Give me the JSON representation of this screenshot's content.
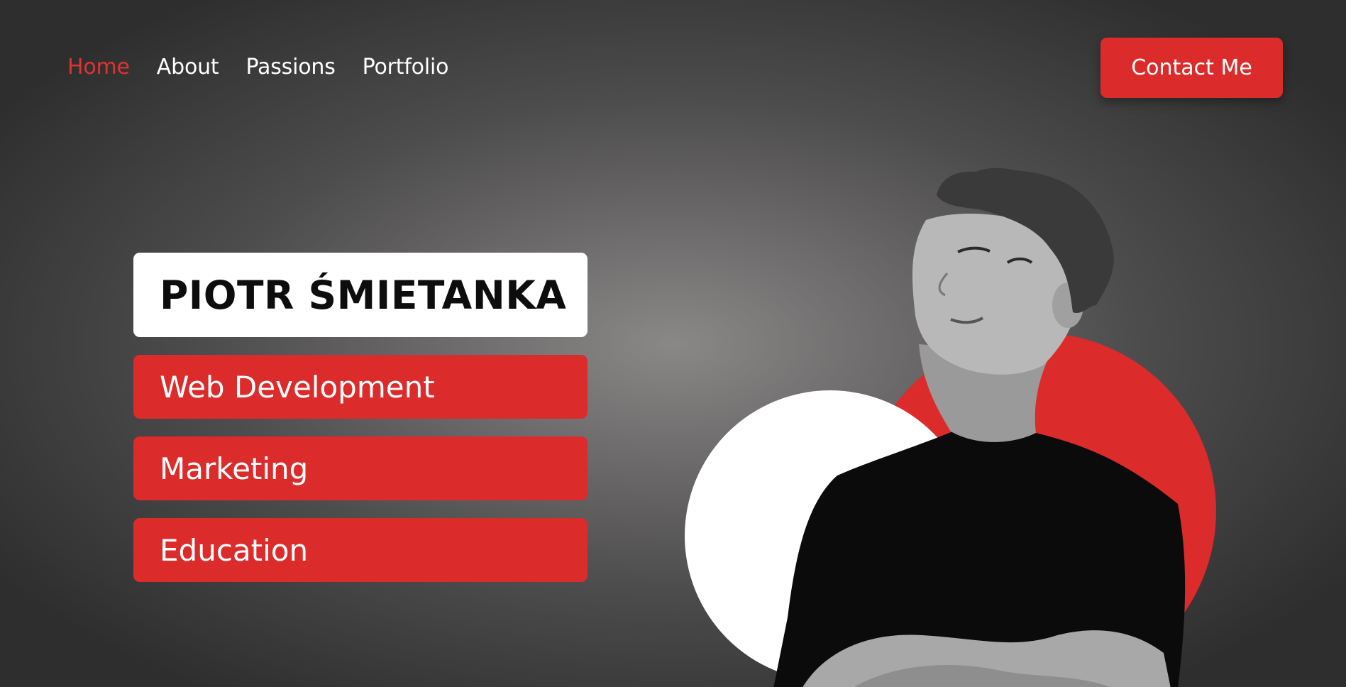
{
  "nav": {
    "items": [
      {
        "label": "Home",
        "active": true
      },
      {
        "label": "About",
        "active": false
      },
      {
        "label": "Passions",
        "active": false
      },
      {
        "label": "Portfolio",
        "active": false
      }
    ],
    "contact_label": "Contact Me"
  },
  "hero": {
    "name": "PIOTR ŚMIETANKA",
    "tags": [
      "Web Development",
      "Marketing",
      "Education"
    ],
    "photo": "portrait-photo"
  },
  "colors": {
    "accent": "#dc2b2b",
    "white": "#ffffff",
    "text_dark": "#0d0d0d",
    "background": "#4d4c4c"
  }
}
